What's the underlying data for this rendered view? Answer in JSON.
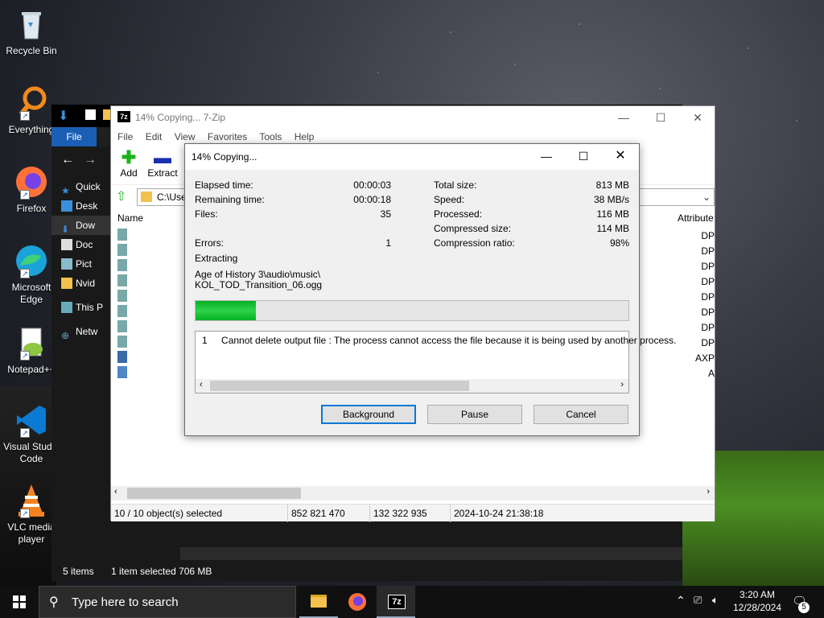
{
  "desktop": {
    "icons": [
      {
        "label": "Recycle Bin"
      },
      {
        "label": "Everything"
      },
      {
        "label": "Firefox"
      },
      {
        "label": "Microsoft Edge"
      },
      {
        "label": "Notepad++"
      },
      {
        "label": "Visual Studio Code"
      },
      {
        "label": "VLC media player"
      }
    ]
  },
  "explorer": {
    "file_tab": "File",
    "sidebar": [
      "Quick",
      "Desk",
      "Dow",
      "Doc",
      "Pict",
      "Nvid",
      "This P",
      "Netw"
    ],
    "status_items": "5 items",
    "status_selected": "1 item selected  706 MB"
  },
  "zip": {
    "title": "14% Copying... 7-Zip",
    "menu": [
      "File",
      "Edit",
      "View",
      "Favorites",
      "Tools",
      "Help"
    ],
    "toolbar": {
      "add": "Add",
      "extract": "Extract"
    },
    "address": "C:\\Use",
    "col_name": "Name",
    "col_attributes": "Attribute",
    "attributes": [
      "DP",
      "DP",
      "DP",
      "DP",
      "DP",
      "DP",
      "DP",
      "DP",
      "AXP",
      "A"
    ],
    "status": {
      "selected": "10 / 10 object(s) selected",
      "size": "852 821 470",
      "packed": "132 322 935",
      "date": "2024-10-24 21:38:18"
    }
  },
  "dialog": {
    "title": "14% Copying...",
    "elapsed_label": "Elapsed time:",
    "elapsed": "00:00:03",
    "remaining_label": "Remaining time:",
    "remaining": "00:00:18",
    "files_label": "Files:",
    "files": "35",
    "errors_label": "Errors:",
    "errors": "1",
    "total_label": "Total size:",
    "total": "813 MB",
    "speed_label": "Speed:",
    "speed": "38 MB/s",
    "processed_label": "Processed:",
    "processed": "116 MB",
    "compressed_label": "Compressed size:",
    "compressed": "114 MB",
    "ratio_label": "Compression ratio:",
    "ratio": "98%",
    "operation": "Extracting",
    "path_line1": "Age of History 3\\audio\\music\\",
    "path_line2": "KOL_TOD_Transition_06.ogg",
    "progress_fraction": 0.14,
    "error_index": "1",
    "error_message": "Cannot delete output file : The process cannot access the file because it is being used by another process.",
    "buttons": {
      "background": "Background",
      "pause": "Pause",
      "cancel": "Cancel"
    }
  },
  "taskbar": {
    "search_placeholder": "Type here to search",
    "time": "3:20 AM",
    "date": "12/28/2024",
    "notification_count": "5"
  },
  "colors": {
    "accent": "#0078d7",
    "progress": "#06b025",
    "explorer_file": "#1a5fb4"
  }
}
